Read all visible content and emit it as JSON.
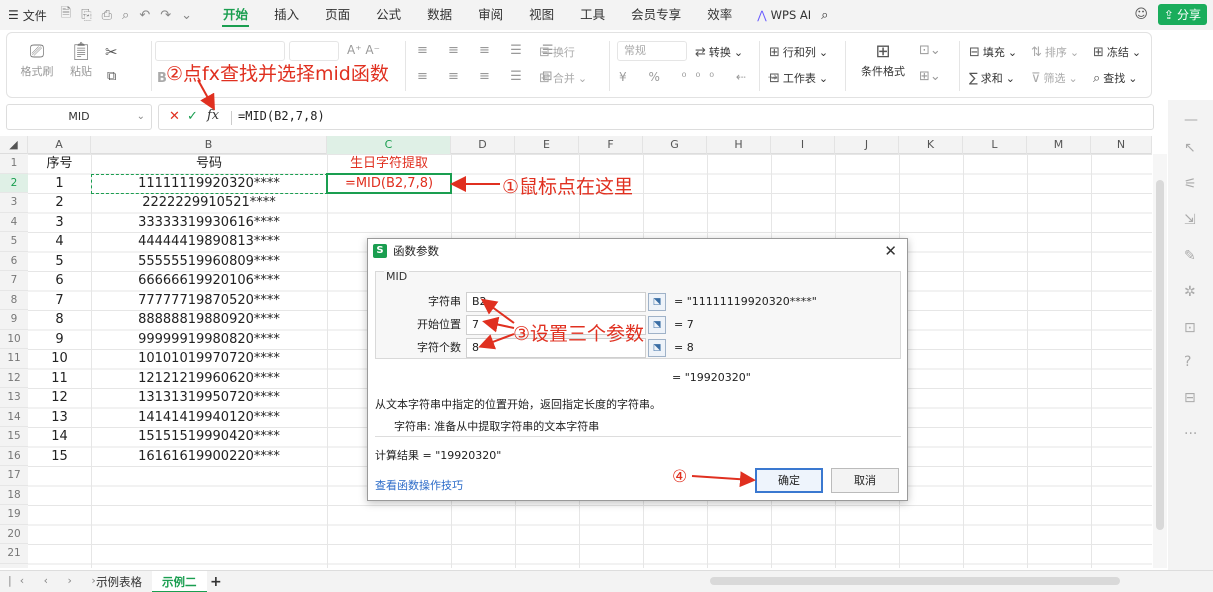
{
  "menu": {
    "file": "文件",
    "tabs": [
      "开始",
      "插入",
      "页面",
      "公式",
      "数据",
      "审阅",
      "视图",
      "工具",
      "会员专享",
      "效率"
    ],
    "active_tab": "开始",
    "wps_ai": "WPS AI",
    "share": "分享"
  },
  "ribbon": {
    "format_painter": "格式刷",
    "paste": "粘贴",
    "wrap": "换行",
    "merge": "合并",
    "number_format": "常规",
    "convert": "转换",
    "row_col": "行和列",
    "worksheet": "工作表",
    "cond_format": "条件格式",
    "fill": "填充",
    "sort": "排序",
    "freeze": "冻结",
    "sum": "求和",
    "filter": "筛选",
    "find": "查找"
  },
  "formula_bar": {
    "name_box": "MID",
    "formula": "=MID(B2,7,8)"
  },
  "annotations": {
    "step1": "①鼠标点在这里",
    "step2": "②点fx查找并选择mid函数",
    "step3": "③设置三个参数",
    "step4": "④"
  },
  "sheet": {
    "columns": [
      "A",
      "B",
      "C",
      "D",
      "E",
      "F",
      "G",
      "H",
      "I",
      "J",
      "K",
      "L",
      "M",
      "N"
    ],
    "row_numbers": [
      "1",
      "2",
      "3",
      "4",
      "5",
      "6",
      "7",
      "8",
      "9",
      "10",
      "11",
      "12",
      "13",
      "14",
      "15",
      "16",
      "17",
      "18",
      "19",
      "20",
      "21"
    ],
    "header": {
      "seq": "序号",
      "code": "号码",
      "birthday": "生日字符提取"
    },
    "rows": [
      {
        "seq": "1",
        "code": "11111119920320****"
      },
      {
        "seq": "2",
        "code": "2222229910521****"
      },
      {
        "seq": "3",
        "code": "33333319930616****"
      },
      {
        "seq": "4",
        "code": "44444419890813****"
      },
      {
        "seq": "5",
        "code": "55555519960809****"
      },
      {
        "seq": "6",
        "code": "66666619920106****"
      },
      {
        "seq": "7",
        "code": "77777719870520****"
      },
      {
        "seq": "8",
        "code": "88888819880920****"
      },
      {
        "seq": "9",
        "code": "99999919980820****"
      },
      {
        "seq": "10",
        "code": "10101019970720****"
      },
      {
        "seq": "11",
        "code": "12121219960620****"
      },
      {
        "seq": "12",
        "code": "13131319950720****"
      },
      {
        "seq": "13",
        "code": "14141419940120****"
      },
      {
        "seq": "14",
        "code": "15151519990420****"
      },
      {
        "seq": "15",
        "code": "16161619900220****"
      }
    ],
    "active_cell_value": "=MID(B2,7,8)",
    "sheet_tabs": [
      "示例表格",
      "示例二"
    ],
    "active_sheet": "示例二",
    "add_sheet": "+"
  },
  "dialog": {
    "title": "函数参数",
    "close": "✕",
    "function_name": "MID",
    "args": [
      {
        "label": "字符串",
        "value": "B2",
        "result": "= \"11111119920320****\""
      },
      {
        "label": "开始位置",
        "value": "7",
        "result": "= 7"
      },
      {
        "label": "字符个数",
        "value": "8",
        "result": "= 8"
      }
    ],
    "overall_result": "= \"19920320\"",
    "description": "从文本字符串中指定的位置开始，返回指定长度的字符串。",
    "arg_help": "字符串:   准备从中提取字符串的文本字符串",
    "calc_result": "计算结果 =  \"19920320\"",
    "help_link": "查看函数操作技巧",
    "ok": "确定",
    "cancel": "取消"
  },
  "colors": {
    "accent": "#1a9e50",
    "annotation": "#e03020"
  }
}
